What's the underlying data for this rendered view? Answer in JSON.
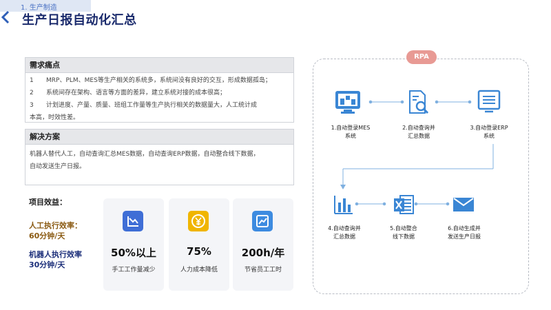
{
  "header": {
    "section_tag": "1. 生产制造",
    "title": "生产日报自动化汇总"
  },
  "pain_points": {
    "heading": "需求痛点",
    "items": [
      {
        "num": "1",
        "text": "MRP、PLM、MES等生产相关的系统多，系统间没有良好的交互，形成数据孤岛；"
      },
      {
        "num": "2",
        "text": "系统间存在架构、语言等方面的差异，建立系统对接的成本很高；"
      },
      {
        "num": "3",
        "text": "计划进度、产量、质量、班组工作量等生产执行相关的数据量大，人工统计成"
      }
    ],
    "item3_cont": "本高，时效性差。"
  },
  "solution": {
    "heading": "解决方案",
    "line1": "机器人替代人工，自动查询汇总MES数据，自动查询ERP数据，自动整合线下数据，",
    "line2": "自动发送生产日报。"
  },
  "benefits": {
    "heading": "项目效益：",
    "manual_label": "人工执行效率：",
    "manual_value": "60分钟/天",
    "robot_label": "机器人执行效率",
    "robot_value": "30分钟/天",
    "cards": [
      {
        "value": "50%以上",
        "label": "手工工作量减少",
        "icon": "chart-down-icon",
        "color": "#3f6ed6"
      },
      {
        "value": "75%",
        "label": "人力成本降低",
        "icon": "yen-coin-icon",
        "color": "#f0b500"
      },
      {
        "value": "200h/年",
        "label": "节省员工工时",
        "icon": "chart-up-icon",
        "color": "#3d8be0"
      }
    ]
  },
  "rpa": {
    "label": "RPA",
    "steps": [
      {
        "line1": "1.自动登录MES",
        "line2": "系统"
      },
      {
        "line1": "2.自动查询并",
        "line2": "汇总数据"
      },
      {
        "line1": "3.自动登录ERP",
        "line2": "系统"
      },
      {
        "line1": "4.自动查询并",
        "line2": "汇总数据"
      },
      {
        "line1": "5.自动整合",
        "line2": "线下数据"
      },
      {
        "line1": "6.自动生成并",
        "line2": "发送生产日报"
      }
    ]
  },
  "colors": {
    "accent": "#3a86d4",
    "title": "#1a2a6c"
  }
}
